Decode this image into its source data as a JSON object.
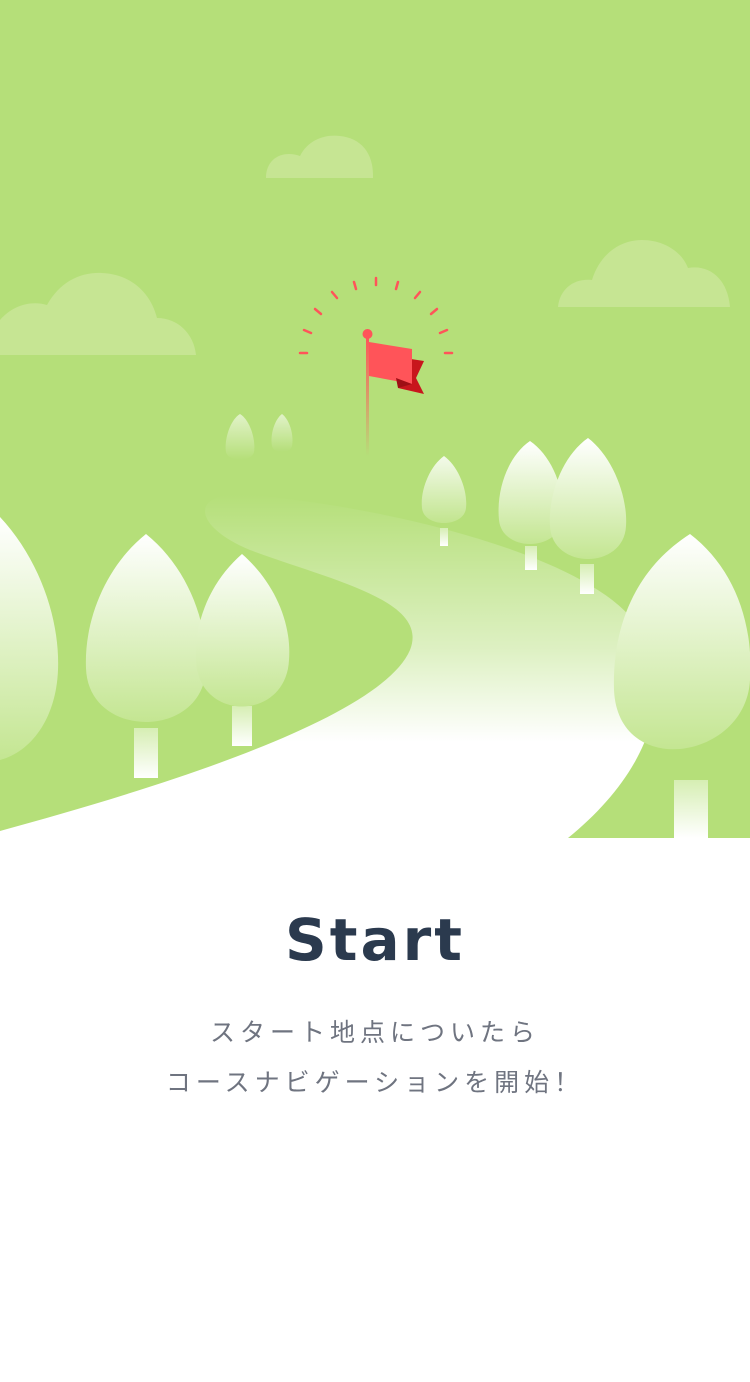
{
  "onboarding": {
    "title": "Start",
    "description_lines": [
      "スタート地点についたら",
      "コースナビゲーションを開始！"
    ]
  },
  "colors": {
    "background_green": "#b5df79",
    "flag_red": "#ff5459",
    "title_navy": "#2b3a4e",
    "body_gray": "#6f7480"
  },
  "icons": {
    "illustration": "start-flag-illustration"
  }
}
